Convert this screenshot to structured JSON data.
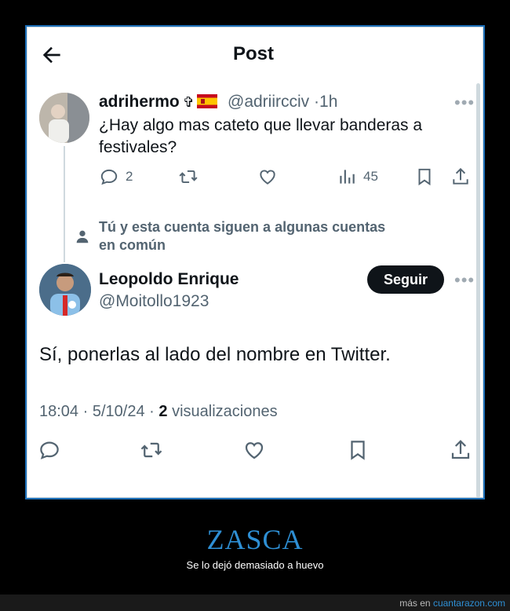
{
  "header": {
    "title": "Post",
    "back_icon": "arrow-left-icon"
  },
  "reply_tweet": {
    "display_name": "adrihermo",
    "name_emoji": "✞",
    "handle": "@adriircciv",
    "separator": "·",
    "time": "1h",
    "text": "¿Hay algo mas cateto que llevar banderas a festivales?",
    "replies": "2",
    "views": "45",
    "icons": [
      "reply-icon",
      "retweet-icon",
      "like-icon",
      "views-icon",
      "bookmark-icon",
      "share-icon"
    ]
  },
  "mutual_notice": {
    "line1": "Tú y esta cuenta siguen a algunas cuentas",
    "line2": "en común"
  },
  "main_tweet": {
    "display_name": "Leopoldo Enrique",
    "handle": "@Moitollo1923",
    "follow_label": "Seguir",
    "text": "Sí, ponerlas al lado del nombre en Twitter.",
    "time": "18:04",
    "dot": "·",
    "date": "5/10/24",
    "dot2": "·",
    "views_count": "2",
    "views_label": "visualizaciones",
    "more": "•••"
  },
  "caption": {
    "title": "ZASCA",
    "subtitle": "Se lo dejó demasiado a huevo"
  },
  "footer": {
    "prefix": "más en",
    "site": "cuantarazon.com"
  },
  "colors": {
    "accent": "#2e8fd4",
    "text": "#0f1419",
    "muted": "#536471",
    "follow_button": "#0f1419"
  }
}
